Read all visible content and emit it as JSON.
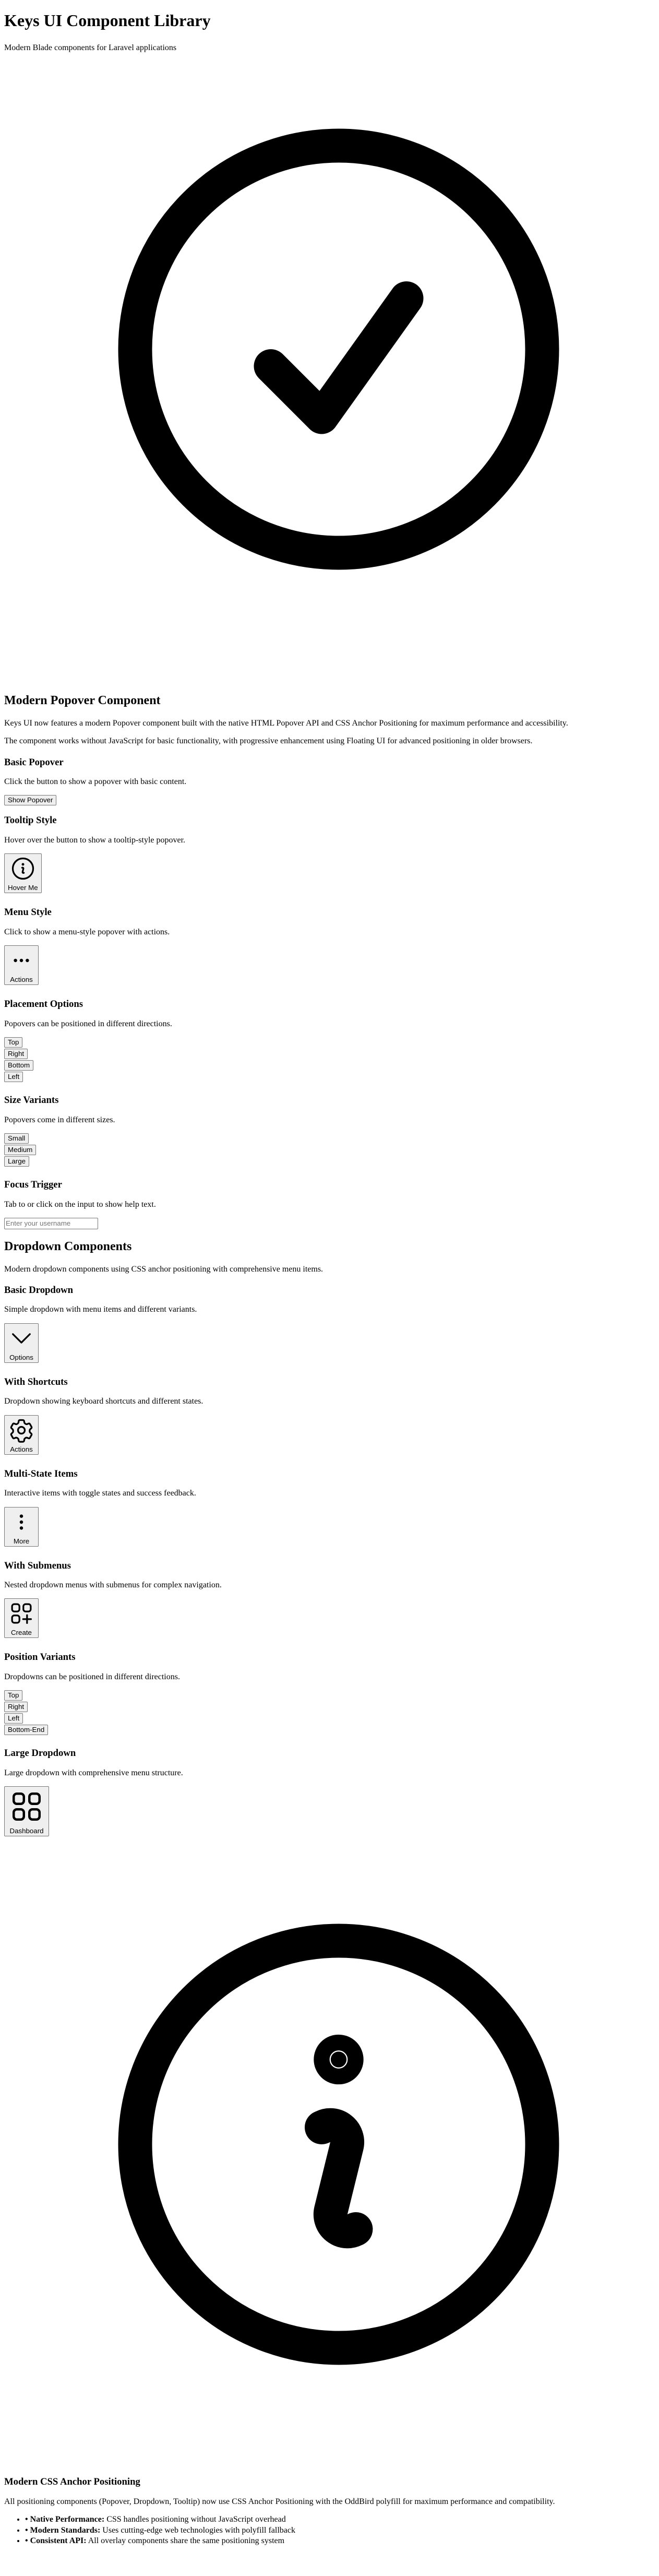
{
  "header": {
    "title": "Keys UI Component Library",
    "subtitle": "Modern Blade components for Laravel applications"
  },
  "popover": {
    "title": "Modern Popover Component",
    "intro1": "Keys UI now features a modern Popover component built with the native HTML Popover API and CSS Anchor Positioning for maximum performance and accessibility.",
    "intro2": "The component works without JavaScript for basic functionality, with progressive enhancement using Floating UI for advanced positioning in older browsers.",
    "basic": {
      "heading": "Basic Popover",
      "desc": "Click the button to show a popover with basic content.",
      "button": "Show Popover"
    },
    "tooltip": {
      "heading": "Tooltip Style",
      "desc": "Hover over the button to show a tooltip-style popover.",
      "button": "Hover Me"
    },
    "menu": {
      "heading": "Menu Style",
      "desc": "Click to show a menu-style popover with actions.",
      "button": "Actions"
    },
    "placement": {
      "heading": "Placement Options",
      "desc": "Popovers can be positioned in different directions.",
      "buttons": [
        "Top",
        "Right",
        "Bottom",
        "Left"
      ]
    },
    "size": {
      "heading": "Size Variants",
      "desc": "Popovers come in different sizes.",
      "buttons": [
        "Small",
        "Medium",
        "Large"
      ]
    },
    "focus": {
      "heading": "Focus Trigger",
      "desc": "Tab to or click on the input to show help text.",
      "placeholder": "Enter your username"
    }
  },
  "dropdown": {
    "title": "Dropdown Components",
    "intro": "Modern dropdown components using CSS anchor positioning with comprehensive menu items.",
    "basic": {
      "heading": "Basic Dropdown",
      "desc": "Simple dropdown with menu items and different variants.",
      "button": "Options"
    },
    "shortcuts": {
      "heading": "With Shortcuts",
      "desc": "Dropdown showing keyboard shortcuts and different states.",
      "button": "Actions"
    },
    "multistate": {
      "heading": "Multi-State Items",
      "desc": "Interactive items with toggle states and success feedback.",
      "button": "More"
    },
    "submenus": {
      "heading": "With Submenus",
      "desc": "Nested dropdown menus with submenus for complex navigation.",
      "button": "Create"
    },
    "position": {
      "heading": "Position Variants",
      "desc": "Dropdowns can be positioned in different directions.",
      "buttons": [
        "Top",
        "Right",
        "Left",
        "Bottom-End"
      ]
    },
    "large": {
      "heading": "Large Dropdown",
      "desc": "Large dropdown with comprehensive menu structure.",
      "button": "Dashboard"
    }
  },
  "anchor": {
    "title": "Modern CSS Anchor Positioning",
    "intro": "All positioning components (Popover, Dropdown, Tooltip) now use CSS Anchor Positioning with the OddBird polyfill for maximum performance and compatibility.",
    "items": [
      {
        "label": "• Native Performance:",
        "text": " CSS handles positioning without JavaScript overhead"
      },
      {
        "label": "• Modern Standards:",
        "text": " Uses cutting-edge web technologies with polyfill fallback"
      },
      {
        "label": "• Consistent API:",
        "text": " All overlay components share the same positioning system"
      }
    ]
  },
  "icons": {
    "hero": "check-circle-icon",
    "info_large": "info-circle-icon",
    "tooltip": "info-circle-icon",
    "menu": "ellipsis-horizontal-icon",
    "options": "chevron-down-icon",
    "shortcuts": "gear-icon",
    "more": "ellipsis-vertical-icon",
    "create": "squares-plus-icon",
    "dashboard": "squares-grid-icon"
  }
}
